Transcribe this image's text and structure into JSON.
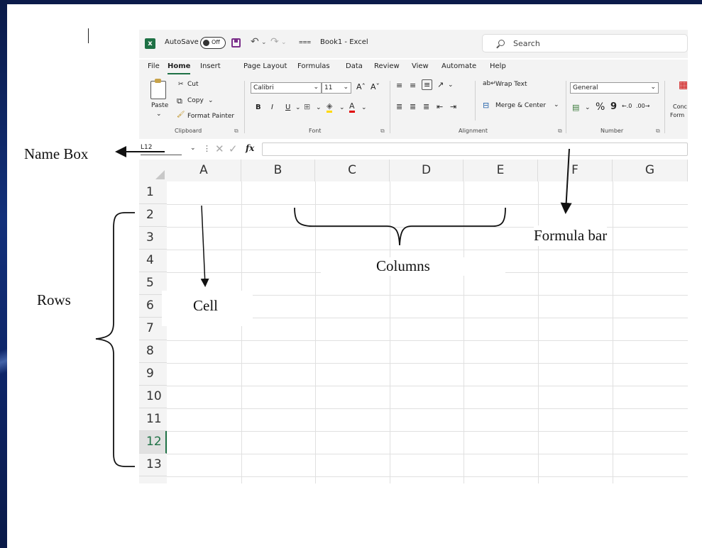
{
  "excel": {
    "autosave_label": "AutoSave",
    "autosave_state": "Off",
    "document_title": "Book1 - Excel",
    "search_placeholder": "Search",
    "tabs": [
      "File",
      "Home",
      "Insert",
      "Page Layout",
      "Formulas",
      "Data",
      "Review",
      "View",
      "Automate",
      "Help"
    ],
    "active_tab": "Home",
    "ribbon": {
      "clipboard": {
        "paste": "Paste",
        "cut": "Cut",
        "copy": "Copy",
        "format_painter": "Format Painter",
        "group": "Clipboard"
      },
      "font": {
        "font_name": "Calibri",
        "font_size": "11",
        "bold": "B",
        "italic": "I",
        "underline": "U",
        "group": "Font"
      },
      "alignment": {
        "wrap_text": "Wrap Text",
        "merge_center": "Merge & Center",
        "group": "Alignment"
      },
      "number": {
        "format": "General",
        "percent": "%",
        "comma": "9",
        "group": "Number"
      },
      "styles": {
        "conditional_line1": "Conc",
        "conditional_line2": "Form"
      }
    },
    "name_box_value": "L12",
    "fx_label": "fx",
    "columns": [
      "A",
      "B",
      "C",
      "D",
      "E",
      "F",
      "G"
    ],
    "rows": [
      "1",
      "2",
      "3",
      "4",
      "5",
      "6",
      "7",
      "8",
      "9",
      "10",
      "11",
      "12",
      "13"
    ],
    "selected_row": "12"
  },
  "annotations": {
    "name_box": "Name Box",
    "formula_bar": "Formula bar",
    "columns": "Columns",
    "rows": "Rows",
    "cell": "Cell"
  }
}
